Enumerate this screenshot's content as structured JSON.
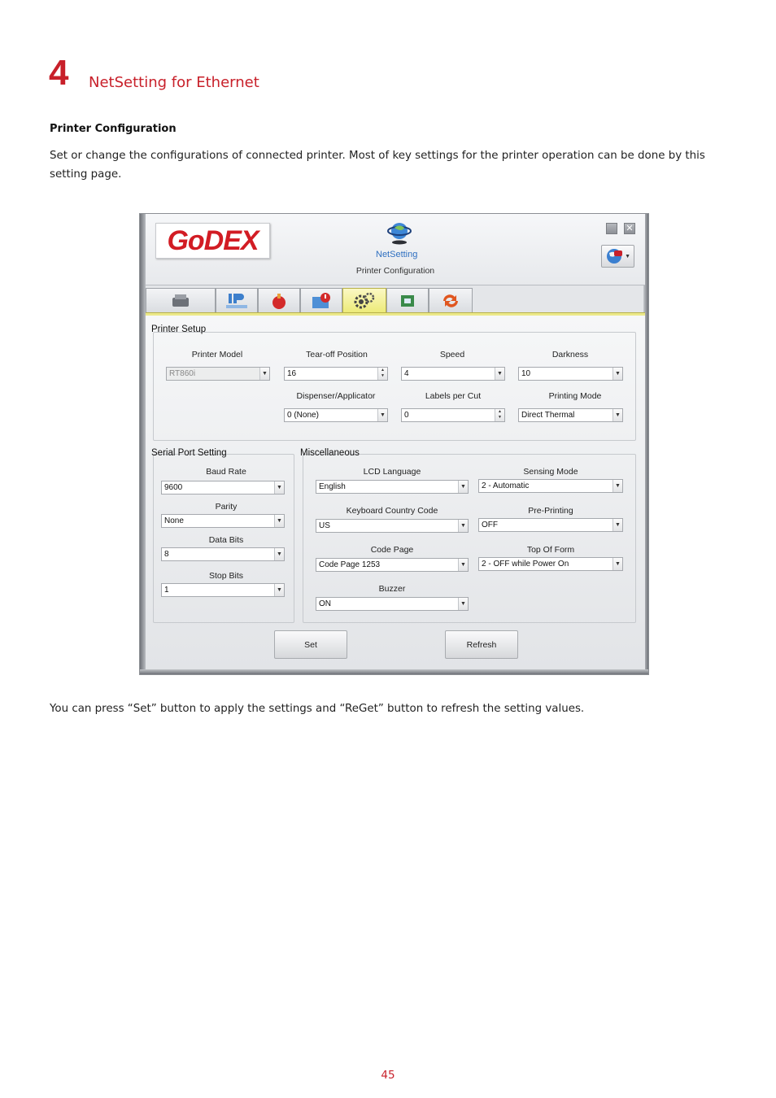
{
  "doc": {
    "chapter_number": "4",
    "chapter_title": "NetSetting for Ethernet",
    "section_heading": "Printer Configuration",
    "intro": "Set or change the configurations of connected printer. Most of key settings for the printer operation can be done by this setting page.",
    "outro": "You can press “Set” button to apply the settings and “ReGet” button to refresh the setting values.",
    "page_number": "45"
  },
  "window": {
    "logo": "GoDEX",
    "app_name": "NetSetting",
    "title": "Printer Configuration",
    "close_glyph": "✕",
    "tabs": [
      {
        "icon": "printer-icon"
      },
      {
        "icon": "ip-network-icon",
        "text": "IP"
      },
      {
        "icon": "alert-bell-icon"
      },
      {
        "icon": "email-alert-icon"
      },
      {
        "icon": "gears-icon",
        "active": true
      },
      {
        "icon": "key-icon"
      },
      {
        "icon": "refresh-arrows-icon"
      }
    ],
    "printer_setup": {
      "title": "Printer Setup",
      "printer_model": {
        "label": "Printer Model",
        "value": "RT860i"
      },
      "tear_off": {
        "label": "Tear-off  Position",
        "value": "16"
      },
      "speed": {
        "label": "Speed",
        "value": "4"
      },
      "darkness": {
        "label": "Darkness",
        "value": "10"
      },
      "dispenser": {
        "label": "Dispenser/Applicator",
        "value": "0 (None)"
      },
      "labels_per_cut": {
        "label": "Labels per Cut",
        "value": "0"
      },
      "printing_mode": {
        "label": "Printing Mode",
        "value": "Direct Thermal"
      }
    },
    "serial_port": {
      "title": "Serial Port Setting",
      "baud_rate": {
        "label": "Baud Rate",
        "value": "9600"
      },
      "parity": {
        "label": "Parity",
        "value": "None"
      },
      "data_bits": {
        "label": "Data Bits",
        "value": "8"
      },
      "stop_bits": {
        "label": "Stop Bits",
        "value": "1"
      }
    },
    "misc": {
      "title": "Miscellaneous",
      "lcd_language": {
        "label": "LCD Language",
        "value": "English"
      },
      "sensing_mode": {
        "label": "Sensing Mode",
        "value": "2 - Automatic"
      },
      "keyboard_country": {
        "label": "Keyboard Country Code",
        "value": "US"
      },
      "pre_printing": {
        "label": "Pre-Printing",
        "value": "OFF"
      },
      "code_page": {
        "label": "Code Page",
        "value": "Code Page 1253"
      },
      "top_of_form": {
        "label": "Top Of Form",
        "value": "2 - OFF while Power On"
      },
      "buzzer": {
        "label": "Buzzer",
        "value": "ON"
      }
    },
    "buttons": {
      "set": "Set",
      "refresh": "Refresh"
    }
  }
}
